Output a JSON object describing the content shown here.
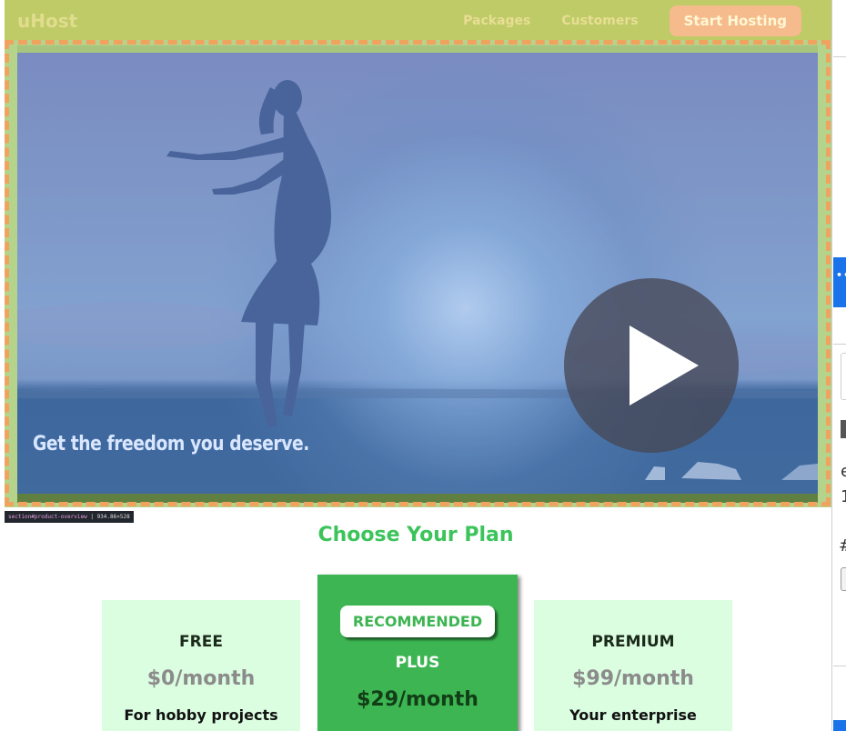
{
  "header": {
    "brand": "uHost",
    "nav": [
      {
        "label": "Packages"
      },
      {
        "label": "Customers"
      }
    ],
    "cta_label": "Start Hosting"
  },
  "hero": {
    "caption": "Get the freedom you deserve."
  },
  "devtools": {
    "element_selector": "section#product-overview",
    "element_size": "934.86×528",
    "panel_glyphs": [
      "e",
      "1",
      "#"
    ]
  },
  "plans": {
    "title": "Choose Your Plan",
    "items": [
      {
        "name": "FREE",
        "price": "$0/month",
        "description": "For hobby projects"
      },
      {
        "badge": "RECOMMENDED",
        "name": "PLUS",
        "price": "$29/month"
      },
      {
        "name": "PREMIUM",
        "price": "$99/month",
        "description": "Your enterprise"
      }
    ]
  },
  "colors": {
    "header_bg": "#8fa52f",
    "cta_bg": "#ee8a6e",
    "accent_green": "#3cc45b",
    "plan_card_bg": "#dbfde0",
    "recommended_bg": "#3cb552"
  },
  "icons": [
    "play-icon"
  ]
}
